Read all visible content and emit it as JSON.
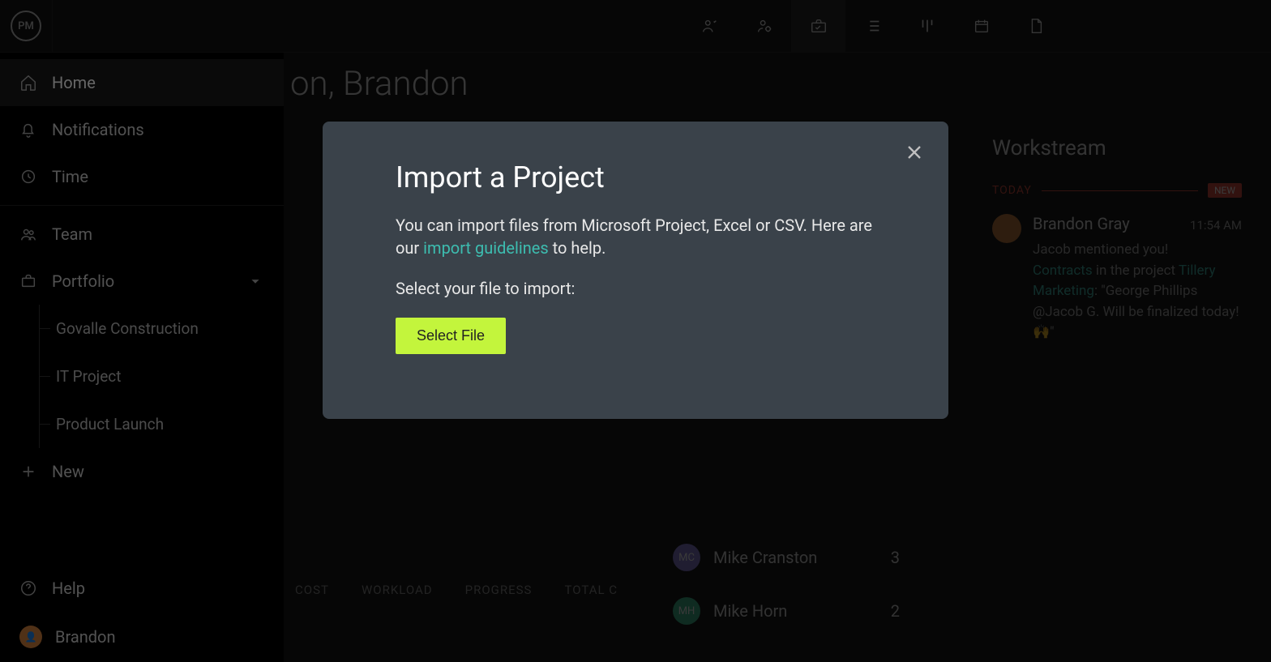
{
  "logo": "PM",
  "sidebar": {
    "items": [
      {
        "label": "Home"
      },
      {
        "label": "Notifications"
      },
      {
        "label": "Time"
      },
      {
        "label": "Team"
      },
      {
        "label": "Portfolio"
      }
    ],
    "portfolio_children": [
      {
        "label": "Govalle Construction"
      },
      {
        "label": "IT Project"
      },
      {
        "label": "Product Launch"
      }
    ],
    "new_label": "New",
    "help_label": "Help",
    "user_label": "Brandon"
  },
  "page_title": "on, Brandon",
  "chart_tabs": [
    "COST",
    "WORKLOAD",
    "PROGRESS",
    "TOTAL C"
  ],
  "team_list": [
    {
      "initials": "MC",
      "name": "Mike Cranston",
      "count": "3",
      "bg": "#8a7ed8"
    },
    {
      "initials": "MH",
      "name": "Mike Horn",
      "count": "2",
      "bg": "#3dbd8f"
    }
  ],
  "workstream": {
    "title": "Workstream",
    "today_label": "TODAY",
    "new_badge": "NEW",
    "item": {
      "author": "Brandon Gray",
      "time": "11:54 AM",
      "line1": "Jacob mentioned you!",
      "link1": "Contracts",
      "mid1": " in the project ",
      "link2": "Tillery Marketing",
      "rest": ": \"George Phillips @Jacob G. Will be finalized today! 🙌\""
    }
  },
  "modal": {
    "title": "Import a Project",
    "desc_part1": "You can import files from Microsoft Project, Excel or CSV. Here are our ",
    "link_text": "import guidelines",
    "desc_part2": " to help.",
    "select_label": "Select your file to import:",
    "button": "Select File"
  }
}
